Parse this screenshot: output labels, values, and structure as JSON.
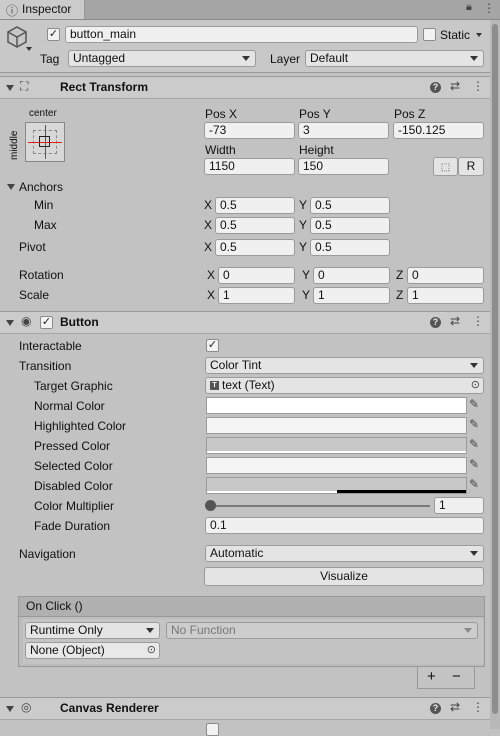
{
  "tab": {
    "title": "Inspector"
  },
  "header": {
    "name": "button_main",
    "static_label": "Static",
    "tag_label": "Tag",
    "tag_value": "Untagged",
    "layer_label": "Layer",
    "layer_value": "Default"
  },
  "rect": {
    "title": "Rect Transform",
    "anchor_h": "center",
    "anchor_v": "middle",
    "posx_label": "Pos X",
    "posy_label": "Pos Y",
    "posz_label": "Pos Z",
    "posx": "-73",
    "posy": "3",
    "posz": "-150.125",
    "width_label": "Width",
    "height_label": "Height",
    "width": "1150",
    "height": "150",
    "r_button": "R",
    "anchors_label": "Anchors",
    "min_label": "Min",
    "max_label": "Max",
    "min_x": "0.5",
    "min_y": "0.5",
    "max_x": "0.5",
    "max_y": "0.5",
    "pivot_label": "Pivot",
    "pivot_x": "0.5",
    "pivot_y": "0.5",
    "rotation_label": "Rotation",
    "rot_x": "0",
    "rot_y": "0",
    "rot_z": "0",
    "scale_label": "Scale",
    "scale_x": "1",
    "scale_y": "1",
    "scale_z": "1",
    "x": "X",
    "y": "Y",
    "z": "Z"
  },
  "button": {
    "title": "Button",
    "interactable_label": "Interactable",
    "transition_label": "Transition",
    "transition_value": "Color Tint",
    "target_label": "Target Graphic",
    "target_value": "text (Text)",
    "normal_label": "Normal Color",
    "highlighted_label": "Highlighted Color",
    "pressed_label": "Pressed Color",
    "selected_label": "Selected Color",
    "disabled_label": "Disabled Color",
    "multiplier_label": "Color Multiplier",
    "multiplier_value": "1",
    "fade_label": "Fade Duration",
    "fade_value": "0.1",
    "navigation_label": "Navigation",
    "navigation_value": "Automatic",
    "visualize_label": "Visualize",
    "onclick_label": "On Click ()",
    "runtime_value": "Runtime Only",
    "function_value": "No Function",
    "object_value": "None (Object)",
    "plus": "+",
    "minus": "−"
  },
  "canvas": {
    "title": "Canvas Renderer"
  },
  "colors": {
    "normal": "#ffffff",
    "highlighted": "#f5f5f5",
    "pressed": "#c8c8c8",
    "selected": "#f5f5f5",
    "disabled": "#c8c8c8"
  }
}
